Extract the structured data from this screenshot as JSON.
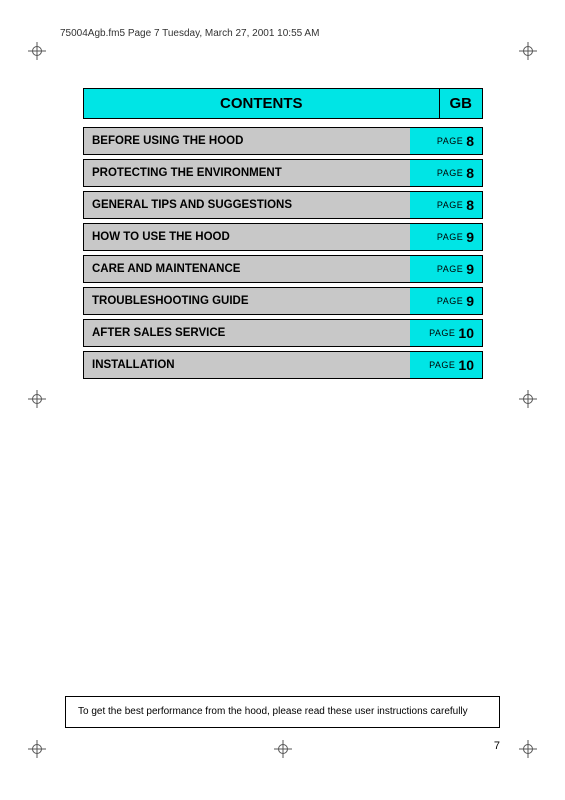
{
  "header": {
    "file_info": "75004Agb.fm5  Page 7  Tuesday, March 27, 2001  10:55 AM"
  },
  "contents": {
    "title": "CONTENTS",
    "gb_label": "GB",
    "rows": [
      {
        "label": "BEFORE USING THE HOOD",
        "page_word": "PAGE",
        "page_num": "8"
      },
      {
        "label": "PROTECTING THE ENVIRONMENT",
        "page_word": "PAGE",
        "page_num": "8"
      },
      {
        "label": "GENERAL TIPS AND SUGGESTIONS",
        "page_word": "PAGE",
        "page_num": "8"
      },
      {
        "label": "HOW TO USE THE HOOD",
        "page_word": "PAGE",
        "page_num": "9"
      },
      {
        "label": "CARE AND MAINTENANCE",
        "page_word": "PAGE",
        "page_num": "9"
      },
      {
        "label": "TROUBLESHOOTING GUIDE",
        "page_word": "PAGE",
        "page_num": "9"
      },
      {
        "label": "AFTER SALES SERVICE",
        "page_word": "PAGE",
        "page_num": "10"
      },
      {
        "label": "INSTALLATION",
        "page_word": "PAGE",
        "page_num": "10"
      }
    ]
  },
  "bottom_note": {
    "text": "To get the best performance from the hood, please read these user instructions carefully"
  },
  "page_number": "7"
}
